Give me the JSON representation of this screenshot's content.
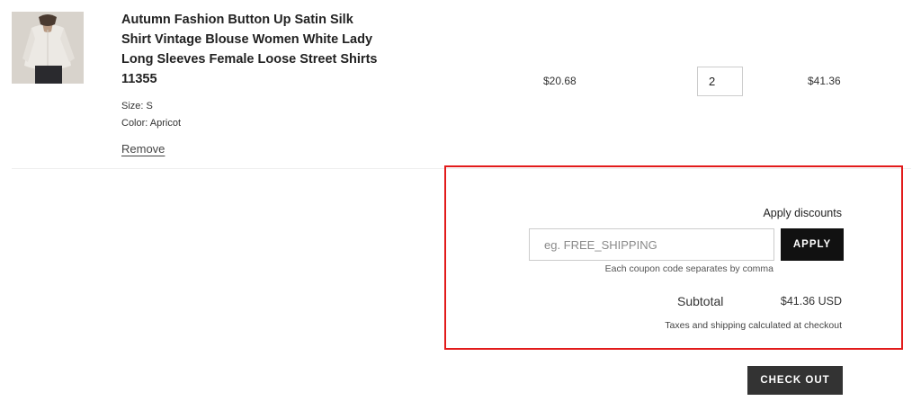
{
  "cart_item": {
    "image_alt": "white satin blouse",
    "title": "Autumn Fashion Button Up Satin Silk Shirt Vintage Blouse Women White Lady Long Sleeves Female Loose Street Shirts 11355",
    "size": "Size: S",
    "color": "Color: Apricot",
    "remove_label": "Remove",
    "unit_price": "$20.68",
    "quantity": "2",
    "line_total": "$41.36"
  },
  "discounts": {
    "label": "Apply discounts",
    "placeholder": "eg. FREE_SHIPPING",
    "apply_label": "APPLY",
    "hint": "Each coupon code separates by comma"
  },
  "summary": {
    "subtotal_label": "Subtotal",
    "subtotal_value": "$41.36 USD",
    "tax_note": "Taxes and shipping calculated at checkout"
  },
  "checkout_label": "CHECK OUT",
  "colors": {
    "highlight_border": "#e21b1b",
    "button_dark": "#111111",
    "checkout_bg": "#333333"
  }
}
